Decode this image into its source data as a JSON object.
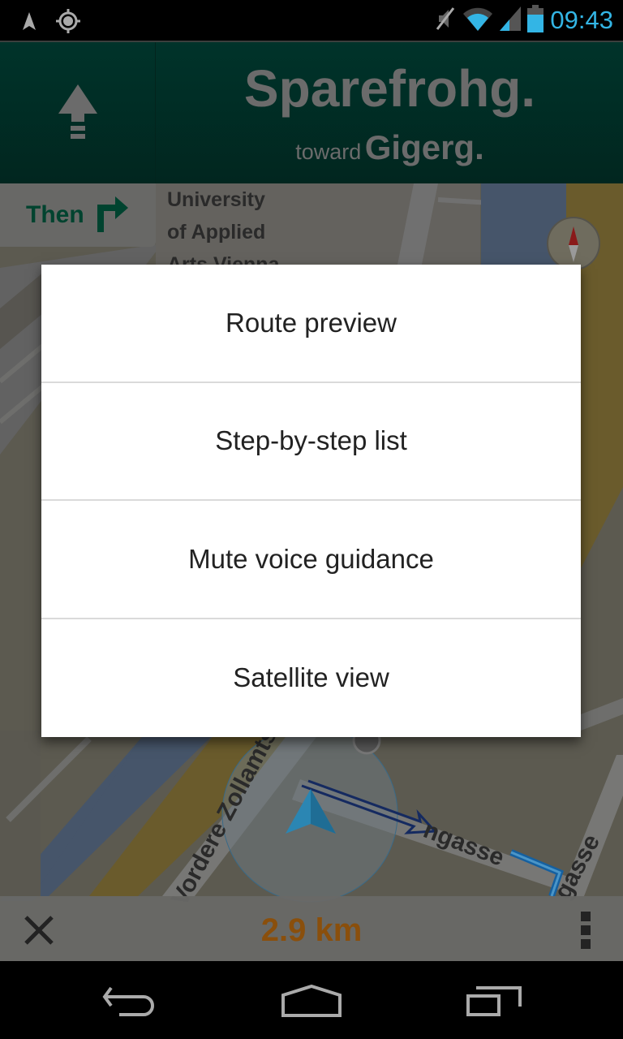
{
  "status_bar": {
    "left_icons": [
      "navigation-arrow-icon",
      "gps-locate-icon"
    ],
    "right_icons": [
      "mute-icon",
      "wifi-icon",
      "cell-signal-icon",
      "battery-icon"
    ],
    "time": "09:43"
  },
  "navigation": {
    "maneuver_icon": "straight-arrow-icon",
    "street": "Sparefrohg.",
    "toward_word": "toward",
    "toward_street": "Gigerg.",
    "then_label": "Then",
    "then_icon": "turn-right-icon"
  },
  "map": {
    "poi_label_lines": [
      "University",
      "of Applied",
      "Arts Vienna"
    ],
    "street_labels": [
      "Vordere Zollamtsstraße",
      "Sparefrohgasse",
      "Gigergasse"
    ],
    "compass_icon": "compass-icon",
    "location_icon": "current-location-arrow-icon"
  },
  "menu": {
    "items": [
      {
        "label": "Route preview"
      },
      {
        "label": "Step-by-step list"
      },
      {
        "label": "Mute voice guidance"
      },
      {
        "label": "Satellite view"
      }
    ]
  },
  "bottom_bar": {
    "close_icon": "close-icon",
    "distance": "2.9 km",
    "overflow_icon": "overflow-menu-icon"
  },
  "system_nav": {
    "back_icon": "back-icon",
    "home_icon": "home-icon",
    "recents_icon": "recents-icon"
  },
  "colors": {
    "status_accent": "#33b5e5",
    "header_bg": "#00332a",
    "then_text": "#00432f",
    "distance_text": "#8a4f0c",
    "menu_bg": "#ffffff",
    "menu_text": "#222222"
  }
}
